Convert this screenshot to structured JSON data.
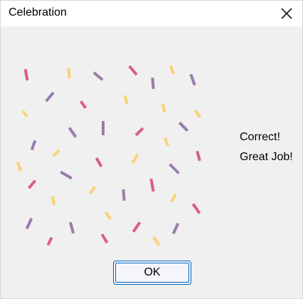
{
  "window": {
    "title": "Celebration"
  },
  "icons": {
    "close": "close-icon"
  },
  "colors": {
    "pink": "#d9607f",
    "purple": "#9a7dab",
    "yellow": "#f9d276",
    "accent": "#0067c0"
  },
  "message": {
    "line1": "Correct!",
    "line2": "Great Job!"
  },
  "buttons": {
    "ok_label": "OK"
  }
}
